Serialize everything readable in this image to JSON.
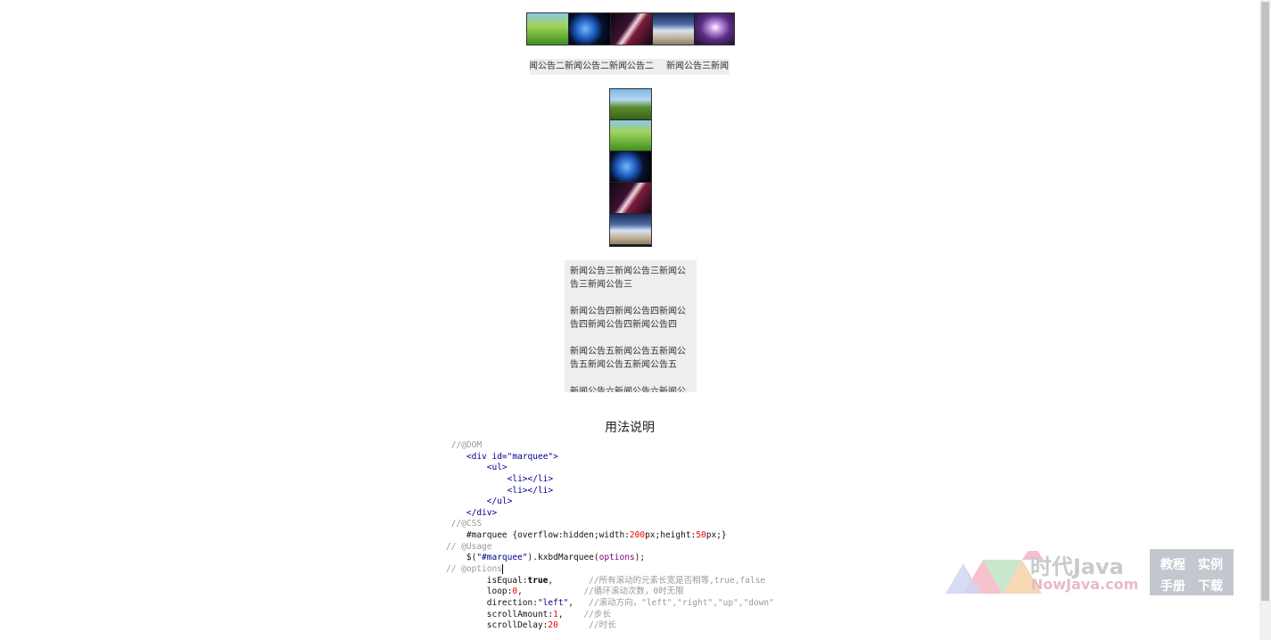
{
  "marquee_images": [
    {
      "name": "grass-image",
      "cls": "t-grass"
    },
    {
      "name": "planet-image",
      "cls": "t-planet"
    },
    {
      "name": "light-streak-image",
      "cls": "t-streak"
    },
    {
      "name": "beach-image",
      "cls": "t-beach"
    },
    {
      "name": "purple-sky-image",
      "cls": "t-purple"
    }
  ],
  "horizontal_notices": [
    "新闻公告二新闻公告二新闻公告二",
    "新闻公告三新闻公告三"
  ],
  "vertical_images": [
    {
      "name": "tree-image",
      "cls": "t-tree"
    },
    {
      "name": "grass-image",
      "cls": "t-grass"
    },
    {
      "name": "planet-image",
      "cls": "t-planet"
    },
    {
      "name": "light-streak-image",
      "cls": "t-streak"
    },
    {
      "name": "beach-image",
      "cls": "t-beach"
    }
  ],
  "vertical_notices": [
    "新闻公告三新闻公告三新闻公告三新闻公告三",
    "新闻公告四新闻公告四新闻公告四新闻公告四新闻公告四",
    "新闻公告五新闻公告五新闻公告五新闻公告五新闻公告五",
    "新闻公告六新闻公告六新闻公告六"
  ],
  "usage_title": "用法说明",
  "code_lines": [
    [
      {
        "t": " //@DOM",
        "c": "cm"
      }
    ],
    [
      {
        "t": "    "
      },
      {
        "t": "<div id=",
        "c": "tg"
      },
      {
        "t": "\"marquee\"",
        "c": "st"
      },
      {
        "t": ">",
        "c": "tg"
      }
    ],
    [
      {
        "t": "        "
      },
      {
        "t": "<ul>",
        "c": "tg"
      }
    ],
    [
      {
        "t": "            "
      },
      {
        "t": "<li></li>",
        "c": "tg"
      }
    ],
    [
      {
        "t": "            "
      },
      {
        "t": "<li></li>",
        "c": "tg"
      }
    ],
    [
      {
        "t": "        "
      },
      {
        "t": "</ul>",
        "c": "tg"
      }
    ],
    [
      {
        "t": "    "
      },
      {
        "t": "</div>",
        "c": "tg"
      }
    ],
    [
      {
        "t": " //@CSS",
        "c": "cm"
      }
    ],
    [
      {
        "t": "    #marquee {overflow:hidden;width:"
      },
      {
        "t": "200",
        "c": "nm"
      },
      {
        "t": "px;height:"
      },
      {
        "t": "50",
        "c": "nm"
      },
      {
        "t": "px;}"
      }
    ],
    [
      {
        "t": "// @Usage",
        "c": "cm"
      }
    ],
    [
      {
        "t": "    $("
      },
      {
        "t": "\"#marquee\"",
        "c": "st"
      },
      {
        "t": ").kxbdMarquee("
      },
      {
        "t": "options",
        "c": "pr"
      },
      {
        "t": ");"
      }
    ],
    [
      {
        "t": "// @options",
        "c": "cm"
      },
      {
        "t": "",
        "c": "caret"
      }
    ],
    [
      {
        "t": "        isEqual:"
      },
      {
        "t": "true",
        "c": "kw"
      },
      {
        "t": ",       "
      },
      {
        "t": "//所有滚动的元素长宽是否相等,true,false",
        "c": "cm"
      }
    ],
    [
      {
        "t": "        loop:"
      },
      {
        "t": "0",
        "c": "nm"
      },
      {
        "t": ",            "
      },
      {
        "t": "//循环滚动次数，0时无限",
        "c": "cm"
      }
    ],
    [
      {
        "t": "        direction:"
      },
      {
        "t": "\"left\"",
        "c": "st"
      },
      {
        "t": ",   "
      },
      {
        "t": "//滚动方向，\"left\",\"right\",\"up\",\"down\"",
        "c": "cm"
      }
    ],
    [
      {
        "t": "        scrollAmount:"
      },
      {
        "t": "1",
        "c": "nm"
      },
      {
        "t": ",    "
      },
      {
        "t": "//步长",
        "c": "cm"
      }
    ],
    [
      {
        "t": "        scrollDelay:"
      },
      {
        "t": "20",
        "c": "nm"
      },
      {
        "t": "      "
      },
      {
        "t": "//时长",
        "c": "cm"
      }
    ]
  ],
  "watermark": {
    "brand_cn": "时代Java",
    "brand_en": "NowJava.com",
    "links": [
      "教程",
      "实例",
      "手册",
      "下载"
    ]
  }
}
